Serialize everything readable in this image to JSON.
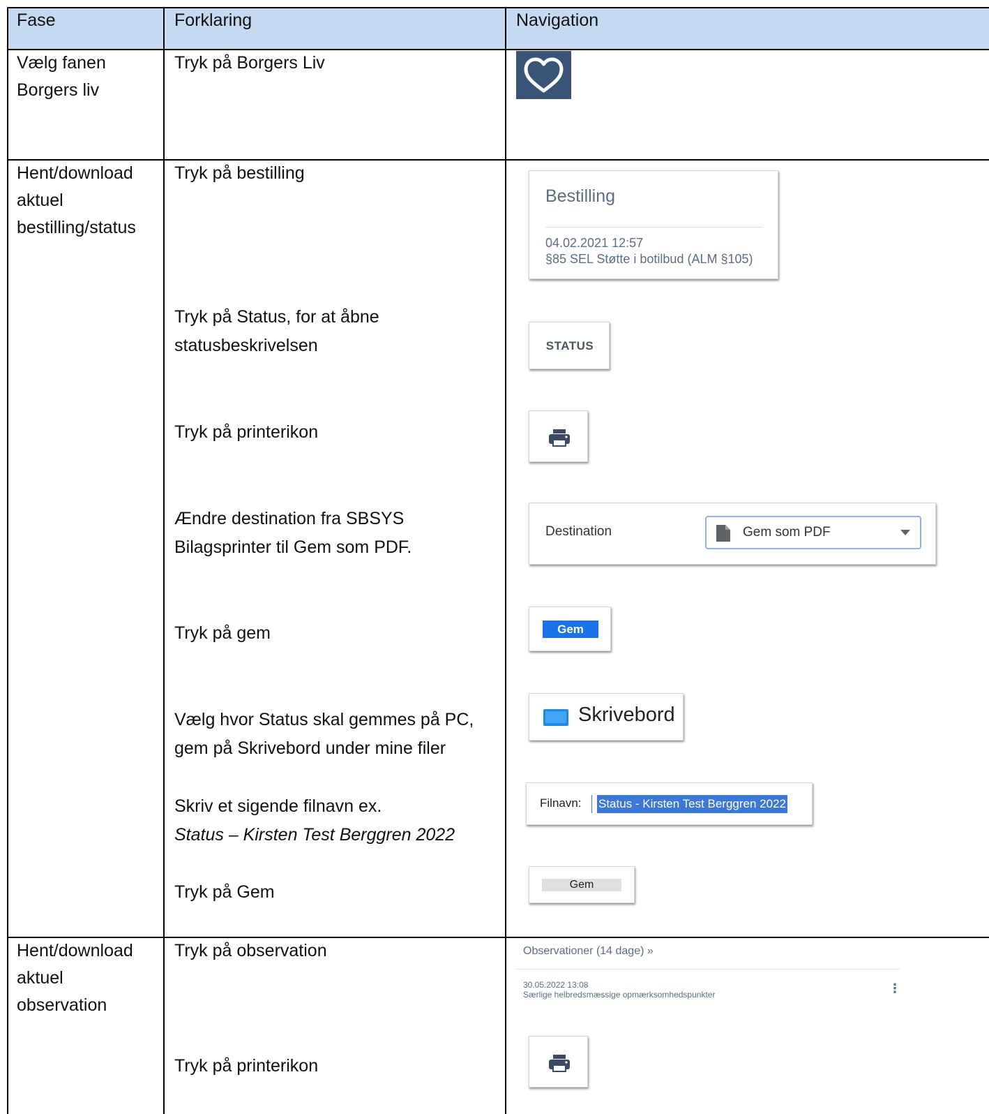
{
  "table": {
    "headers": {
      "fase": "Fase",
      "forklaring": "Forklaring",
      "navigation": "Navigation"
    },
    "row1": {
      "fase_line1": "Vælg fanen",
      "fase_line2": "Borgers liv",
      "forklaring": "Tryk på Borgers Liv",
      "nav_icon": "heart-icon",
      "nav_icon_bg": "#3a5478"
    },
    "row2": {
      "fase_line1": "Hent/download",
      "fase_line2": "aktuel",
      "fase_line3": "bestilling/status",
      "steps": {
        "s1": "Tryk på bestilling",
        "s2_line1": "Tryk på Status, for at åbne",
        "s2_line2": "statusbeskrivelsen",
        "s3": "Tryk på printerikon",
        "s4_line1": "Ændre destination fra SBSYS",
        "s4_line2": "Bilagsprinter til Gem som PDF.",
        "s5": "Tryk på gem",
        "s6_line1": "Vælg hvor Status skal gemmes på PC,",
        "s6_line2": "gem på Skrivebord under mine filer",
        "s7_line1": "Skriv et sigende filnavn ex.",
        "s7_line2": "Status – Kirsten Test Berggren 2022",
        "s8": "Tryk på Gem"
      },
      "nav": {
        "bestilling_title": "Bestilling",
        "bestilling_date": "04.02.2021 12:57",
        "bestilling_desc": "§85 SEL Støtte i botilbud (ALM §105)",
        "status_button": "STATUS",
        "destination_label": "Destination",
        "destination_value": "Gem som PDF",
        "gem_button_blue": "Gem",
        "skrivebord_label": "Skrivebord",
        "filnavn_label": "Filnavn:",
        "filnavn_value": "Status - Kirsten Test Berggren 2022",
        "gem_button_grey": "Gem"
      }
    },
    "row3": {
      "fase_line1": "Hent/download",
      "fase_line2": "aktuel",
      "fase_line3": "observation",
      "steps": {
        "s1": "Tryk på observation",
        "s2": "Tryk på printerikon"
      },
      "nav": {
        "obs_title": "Observationer (14 dage) »",
        "obs_date": "30.05.2022 13:08",
        "obs_desc": "Særlige helbredsmæssige opmærksomhedspunkter",
        "more_icon": "⋮"
      }
    }
  },
  "colors": {
    "header_bg": "#c5d9f1",
    "card_title": "#5b6e86",
    "selection_blue": "#1a73e8",
    "filnavn_highlight": "#3c78d8"
  }
}
